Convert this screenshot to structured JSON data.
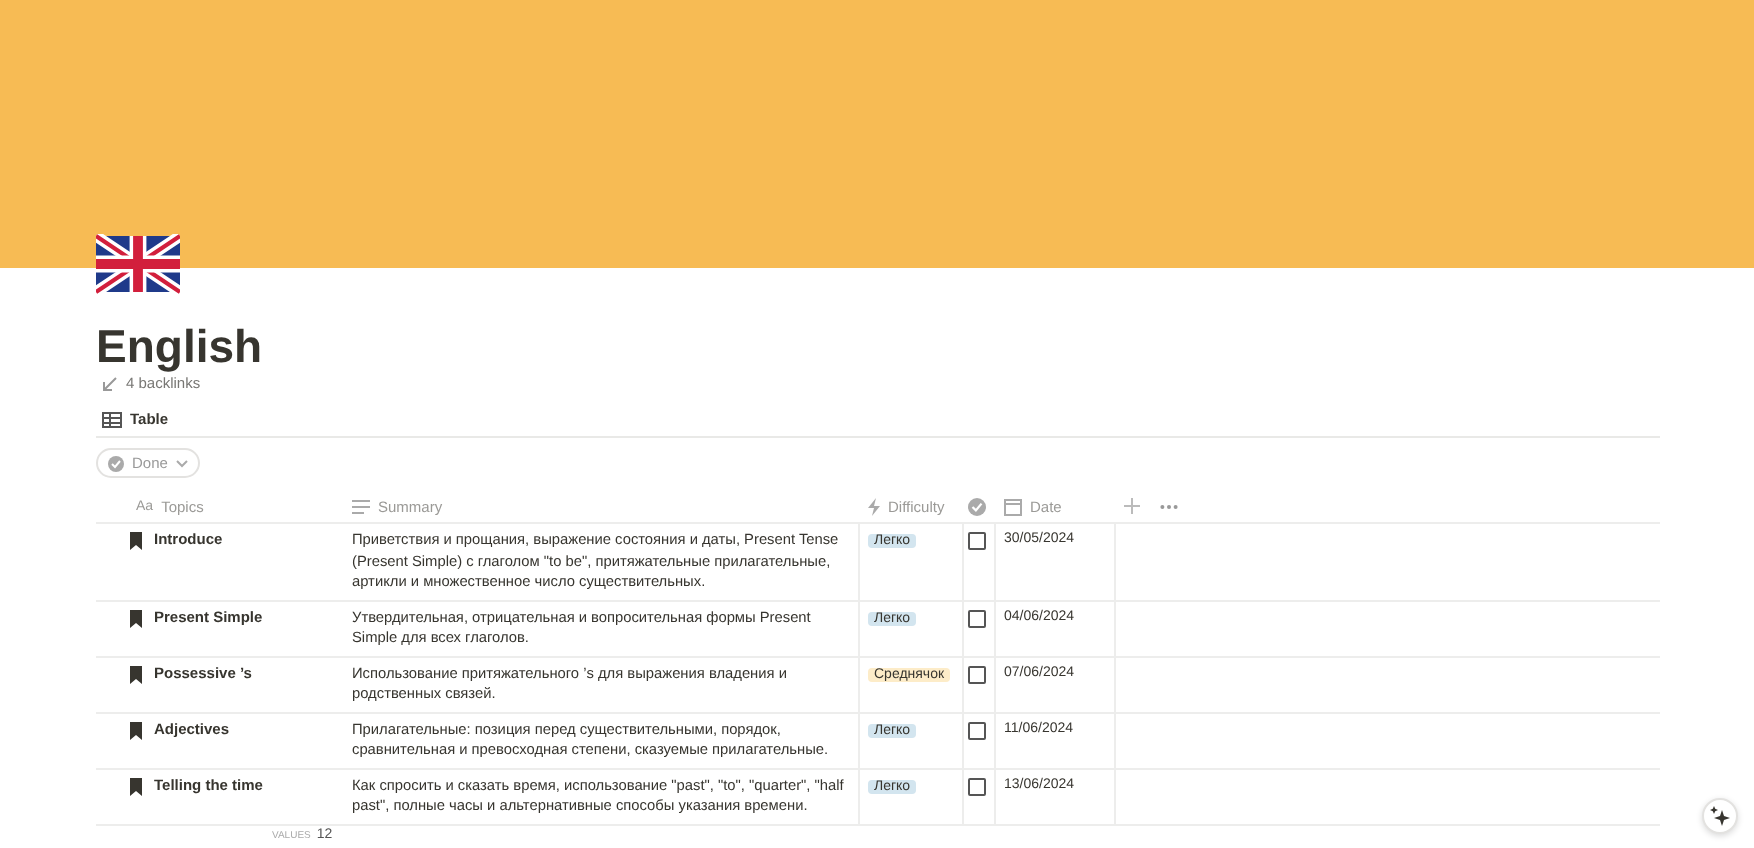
{
  "page": {
    "title": "English",
    "backlinks": "4 backlinks"
  },
  "view_tab": {
    "label": "Table",
    "selected": true
  },
  "filter": {
    "label": "Done"
  },
  "table": {
    "columns": [
      {
        "kind": "title",
        "label": "Topics",
        "prefix": "Aa"
      },
      {
        "kind": "text",
        "label": "Summary"
      },
      {
        "kind": "select",
        "label": "Difficulty"
      },
      {
        "kind": "check"
      },
      {
        "kind": "date",
        "label": "Date"
      }
    ],
    "rows": [
      {
        "topic": "Introduce",
        "summary": "Приветствия и прощания, выражение состояния и даты, Present Tense (Present Simple) с глаголом \"to be\", притяжательные прилагательные, артикли и множественное число существительных.",
        "difficulty": {
          "label": "Легко",
          "color": "#d3e5ef"
        },
        "done": false,
        "date": "30/05/2024"
      },
      {
        "topic": "Present Simple",
        "summary": "Утвердительная, отрицательная и вопросительная формы Present Simple для всех глаголов.",
        "difficulty": {
          "label": "Легко",
          "color": "#d3e5ef"
        },
        "done": false,
        "date": "04/06/2024"
      },
      {
        "topic": "Possessive ’s",
        "summary": "Использование притяжательного ’s для выражения владения и родственных связей.",
        "difficulty": {
          "label": "Среднячок",
          "color": "#fdecc8"
        },
        "done": false,
        "date": "07/06/2024"
      },
      {
        "topic": "Adjectives",
        "summary": "Прилагательные: позиция перед существительными, порядок, сравнительная и превосходная степени, сказуемые прилагательные.",
        "difficulty": {
          "label": "Легко",
          "color": "#d3e5ef"
        },
        "done": false,
        "date": "11/06/2024"
      },
      {
        "topic": "Telling the time",
        "summary": "Как спросить и сказать время, использование \"past\", \"to\", \"quarter\", \"half past\", полные часы и альтернативные способы указания времени.",
        "difficulty": {
          "label": "Легко",
          "color": "#d3e5ef"
        },
        "done": false,
        "date": "13/06/2024"
      }
    ],
    "footer": {
      "label": "VALUES",
      "value": "12"
    }
  }
}
